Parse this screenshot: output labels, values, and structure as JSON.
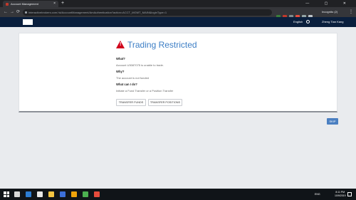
{
  "browser": {
    "tab_title": "Account Management",
    "tab_close": "×",
    "new_tab": "+",
    "window_controls": "— ▢ ✕",
    "back": "←",
    "forward": "→",
    "reload": "⟳",
    "url": "interactivebrokers.com.hk/AccountManagement/AmAuthentication?action=ACCT_MGMT_MAIN&loginType=1",
    "profile_label": "Incognito (2)",
    "menu": "⋮",
    "extension_colors": [
      "#3a7d3a",
      "#c0392b",
      "#7f8c8d",
      "#e74c3c",
      "#95a5a6",
      "#bdc3c7"
    ]
  },
  "site": {
    "language": "English",
    "user_name": "Zheng Tian Kang"
  },
  "main": {
    "title": "Trading Restricted",
    "warning_glyph": "!",
    "what_label": "What?",
    "what_text": "Account U3087075 is unable to trade.",
    "why_label": "Why?",
    "why_text": "The account is not funded",
    "todo_label": "What can I do?",
    "todo_text": "Initiate a Fund Transfer or a Position Transfer",
    "btn_transfer_funds": "TRANSFER FUNDS",
    "btn_transfer_positions": "TRANSFER POSITIONS",
    "skip": "SKIP"
  },
  "taskbar": {
    "app_colors": [
      "#d9d9d9",
      "#2d7dd2",
      "#e8e8e8",
      "#f5c542",
      "#3c6fd8",
      "#f0a30a",
      "#4caf50",
      "#e74c3c"
    ],
    "tray": "ENG",
    "time": "8:11 PM",
    "date": "10/9/2019"
  },
  "colors": {
    "accent_title": "#3c7ec5",
    "warning": "#d0021b",
    "site_header": "#0a1f3d",
    "skip_button": "#4a7fc1"
  }
}
